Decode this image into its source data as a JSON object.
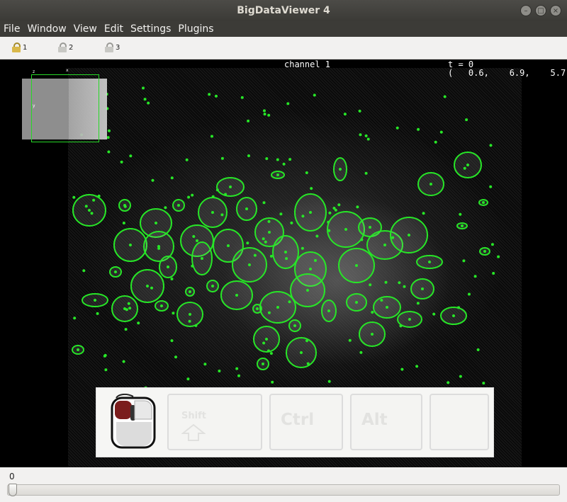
{
  "window": {
    "title": "BigDataViewer 4"
  },
  "menu": [
    "File",
    "Window",
    "View",
    "Edit",
    "Settings",
    "Plugins"
  ],
  "toolbar": {
    "groups": [
      "1",
      "2",
      "3"
    ]
  },
  "viewer": {
    "channel_label": "channel 1",
    "time_label": "t = 0",
    "coords_label": "(   0.6,    6.9,    5.7)",
    "overview_axes": {
      "z": "z",
      "x": "x",
      "y": "y"
    }
  },
  "keyhint": {
    "shift": "Shift",
    "ctrl": "Ctrl",
    "alt": "Alt"
  },
  "timeline": {
    "value": "0",
    "position": 0
  },
  "colors": {
    "detection": "#27e627",
    "window_bg": "#3c3b37"
  },
  "icons": {
    "lock": "lock-icon",
    "mouse": "mouse-icon",
    "close": "close-icon"
  }
}
